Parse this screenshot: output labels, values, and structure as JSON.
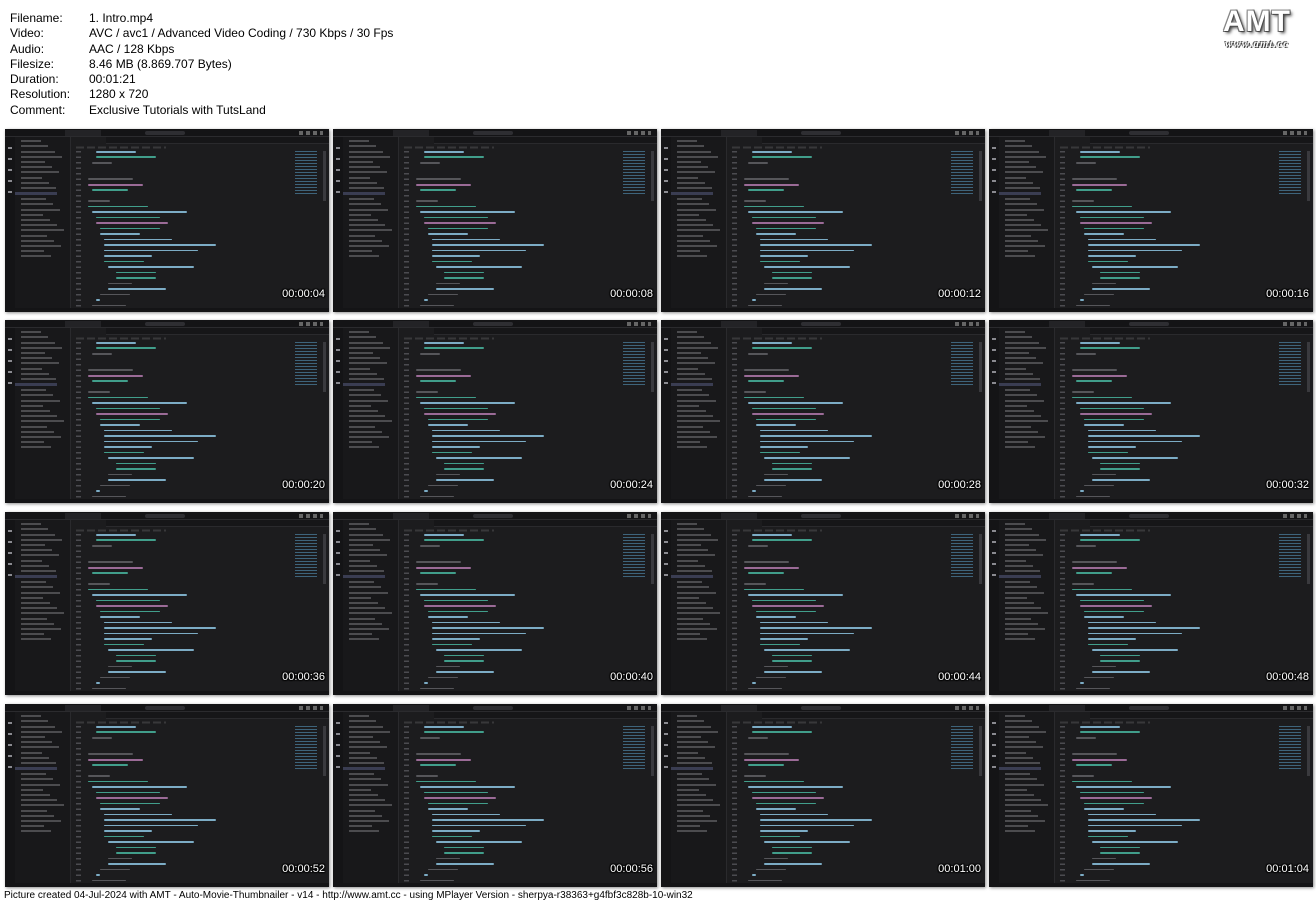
{
  "metadata": [
    {
      "key": "Filename:",
      "value": "1. Intro.mp4"
    },
    {
      "key": "Video:",
      "value": "AVC / avc1 / Advanced Video Coding / 730 Kbps / 30 Fps"
    },
    {
      "key": "Audio:",
      "value": "AAC / 128 Kbps"
    },
    {
      "key": "Filesize:",
      "value": "8.46 MB (8.869.707 Bytes)"
    },
    {
      "key": "Duration:",
      "value": "00:01:21"
    },
    {
      "key": "Resolution:",
      "value": "1280 x 720"
    },
    {
      "key": "Comment:",
      "value": "Exclusive Tutorials with TutsLand"
    }
  ],
  "logo": {
    "main": "AMT",
    "sub": "www.amt.cc"
  },
  "thumbnails": [
    {
      "timestamp": "00:00:04"
    },
    {
      "timestamp": "00:00:08"
    },
    {
      "timestamp": "00:00:12"
    },
    {
      "timestamp": "00:00:16"
    },
    {
      "timestamp": "00:00:20"
    },
    {
      "timestamp": "00:00:24"
    },
    {
      "timestamp": "00:00:28"
    },
    {
      "timestamp": "00:00:32"
    },
    {
      "timestamp": "00:00:36"
    },
    {
      "timestamp": "00:00:40"
    },
    {
      "timestamp": "00:00:44"
    },
    {
      "timestamp": "00:00:48"
    },
    {
      "timestamp": "00:00:52"
    },
    {
      "timestamp": "00:00:56"
    },
    {
      "timestamp": "00:01:00"
    },
    {
      "timestamp": "00:01:04"
    }
  ],
  "footer": "Picture created 04-Jul-2024 with AMT - Auto-Movie-Thumbnailer - v14 - http://www.amt.cc - using MPlayer Version - sherpya-r38363+g4fbf3c828b-10-win32",
  "colors": {
    "background": "#ffffff",
    "ide_background": "#1c1c1e",
    "code_keyword": "#c586c0",
    "code_type": "#4ec9b0",
    "code_text": "#9cdcfe",
    "code_string": "#ce9178",
    "code_comment": "#6a6a6f"
  }
}
